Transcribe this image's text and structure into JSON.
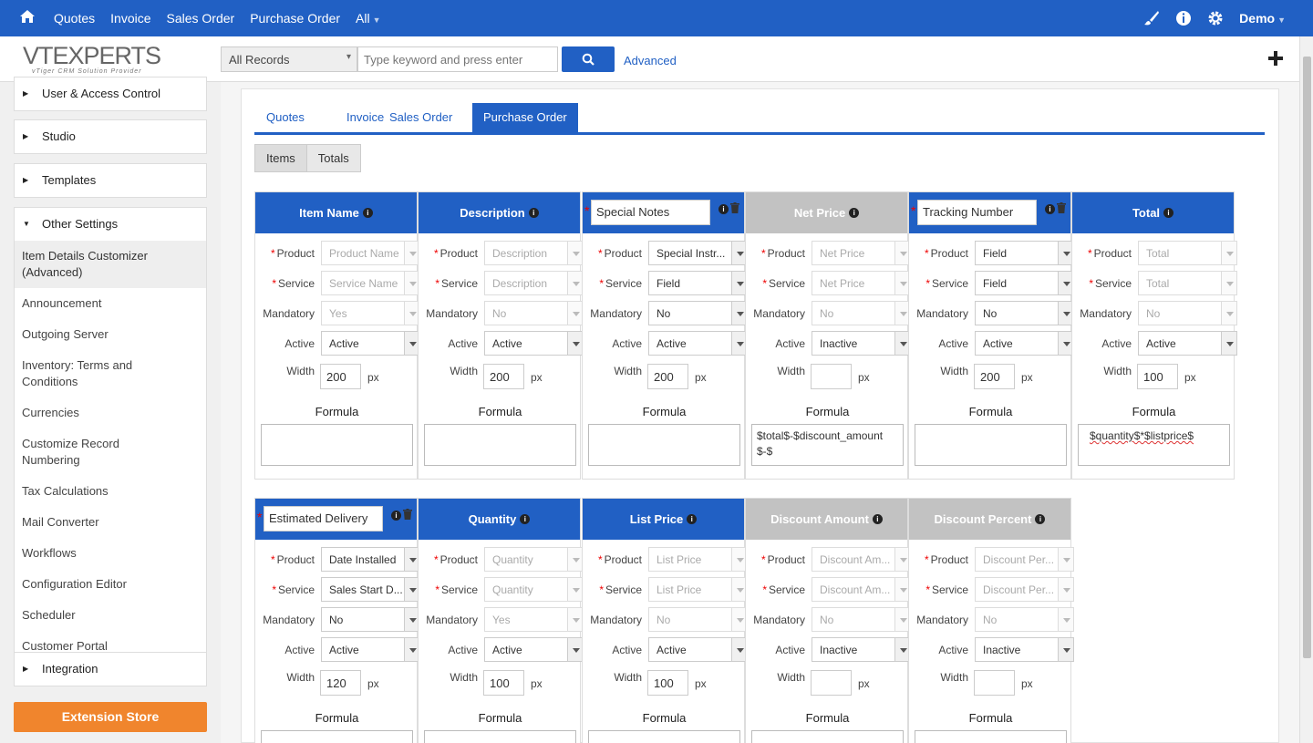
{
  "topnav": {
    "items": [
      "Quotes",
      "Invoice",
      "Sales Order",
      "Purchase Order",
      "All"
    ],
    "user": "Demo"
  },
  "header": {
    "logo_main": "VTEXPERTS",
    "logo_sub": "vTiger CRM Solution Provider",
    "record_select": "All Records",
    "search_placeholder": "Type keyword and press enter",
    "advanced": "Advanced"
  },
  "sidebar": {
    "sections": [
      "User & Access Control",
      "Studio",
      "Templates",
      "Other Settings",
      "Integration"
    ],
    "other_items": [
      "Item Details Customizer (Advanced)",
      "Announcement",
      "Outgoing Server",
      "Inventory: Terms and Conditions",
      "Currencies",
      "Customize Record Numbering",
      "Tax Calculations",
      "Mail Converter",
      "Workflows",
      "Configuration Editor",
      "Scheduler",
      "Customer Portal"
    ],
    "extension_store": "Extension Store"
  },
  "tabs": [
    "Quotes",
    "Invoice",
    "Sales Order",
    "Purchase Order"
  ],
  "subtabs": [
    "Items",
    "Totals"
  ],
  "labels": {
    "product": "Product",
    "service": "Service",
    "mandatory": "Mandatory",
    "active": "Active",
    "width": "Width",
    "px": "px",
    "formula": "Formula",
    "required": "*"
  },
  "columns": [
    {
      "title": "Item Name",
      "custom": false,
      "gray": false,
      "product": "Product Name",
      "product_dis": true,
      "service": "Service Name",
      "service_dis": true,
      "mandatory": "Yes",
      "mandatory_dis": true,
      "active": "Active",
      "width": "200",
      "formula": ""
    },
    {
      "title": "Description",
      "custom": false,
      "gray": false,
      "product": "Description",
      "product_dis": true,
      "service": "Description",
      "service_dis": true,
      "mandatory": "No",
      "mandatory_dis": true,
      "active": "Active",
      "width": "200",
      "formula": ""
    },
    {
      "title": "Special Notes",
      "custom": true,
      "gray": false,
      "product": "Special Instr...",
      "product_dis": false,
      "service": "Field",
      "service_dis": false,
      "mandatory": "No",
      "mandatory_dis": false,
      "active": "Active",
      "width": "200",
      "formula": ""
    },
    {
      "title": "Net Price",
      "custom": false,
      "gray": true,
      "product": "Net Price",
      "product_dis": true,
      "service": "Net Price",
      "service_dis": true,
      "mandatory": "No",
      "mandatory_dis": true,
      "active": "Inactive",
      "width": "",
      "formula": "$total$-$discount_amount$-$"
    },
    {
      "title": "Tracking Number",
      "custom": true,
      "gray": false,
      "product": "Field",
      "product_dis": false,
      "service": "Field",
      "service_dis": false,
      "mandatory": "No",
      "mandatory_dis": false,
      "active": "Active",
      "width": "200",
      "formula": ""
    },
    {
      "title": "Total",
      "custom": false,
      "gray": false,
      "product": "Total",
      "product_dis": true,
      "service": "Total",
      "service_dis": true,
      "mandatory": "No",
      "mandatory_dis": true,
      "active": "Active",
      "width": "100",
      "formula": "$quantity$*$listprice$"
    },
    {
      "title": "Estimated Delivery",
      "custom": true,
      "gray": false,
      "product": "Date Installed",
      "product_dis": false,
      "service": "Sales Start D...",
      "service_dis": false,
      "mandatory": "No",
      "mandatory_dis": false,
      "active": "Active",
      "width": "120",
      "formula": ""
    },
    {
      "title": "Quantity",
      "custom": false,
      "gray": false,
      "product": "Quantity",
      "product_dis": true,
      "service": "Quantity",
      "service_dis": true,
      "mandatory": "Yes",
      "mandatory_dis": true,
      "active": "Active",
      "width": "100",
      "formula": ""
    },
    {
      "title": "List Price",
      "custom": false,
      "gray": false,
      "product": "List Price",
      "product_dis": true,
      "service": "List Price",
      "service_dis": true,
      "mandatory": "No",
      "mandatory_dis": true,
      "active": "Active",
      "width": "100",
      "formula": ""
    },
    {
      "title": "Discount Amount",
      "custom": false,
      "gray": true,
      "product": "Discount Am...",
      "product_dis": true,
      "service": "Discount Am...",
      "service_dis": true,
      "mandatory": "No",
      "mandatory_dis": true,
      "active": "Inactive",
      "width": "",
      "formula": ""
    },
    {
      "title": "Discount Percent",
      "custom": false,
      "gray": true,
      "product": "Discount Per...",
      "product_dis": true,
      "service": "Discount Per...",
      "service_dis": true,
      "mandatory": "No",
      "mandatory_dis": true,
      "active": "Inactive",
      "width": "",
      "formula": ""
    }
  ],
  "colors": {
    "primary": "#2160c4",
    "orange": "#f0852d",
    "gray_header": "#c2c2c2"
  }
}
